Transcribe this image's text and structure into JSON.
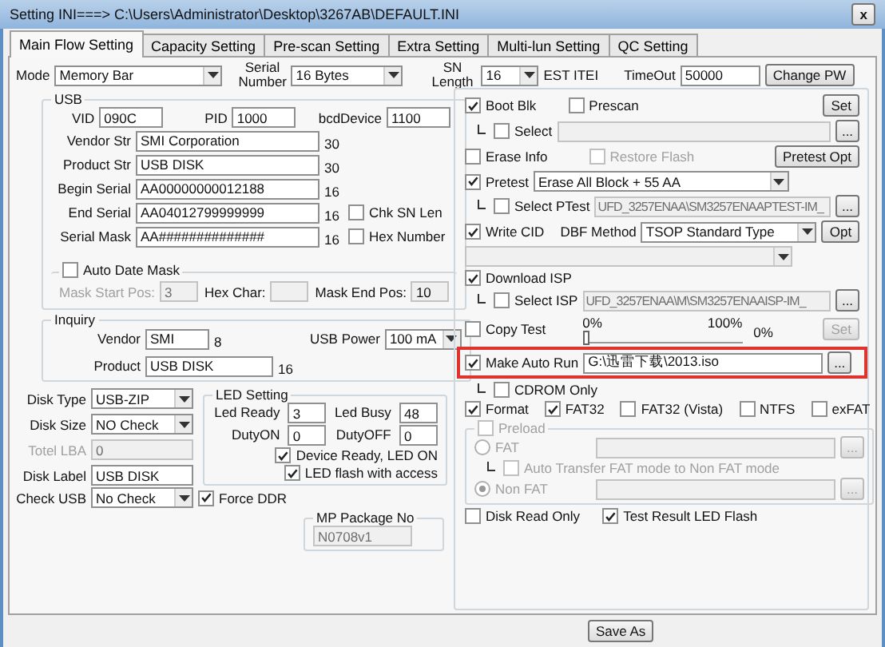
{
  "window": {
    "title": "Setting  INI===> C:\\Users\\Administrator\\Desktop\\3267AB\\DEFAULT.INI",
    "close": "x"
  },
  "tabs": [
    {
      "label": "Main Flow Setting",
      "selected": true
    },
    {
      "label": "Capacity Setting",
      "selected": false
    },
    {
      "label": "Pre-scan Setting",
      "selected": false
    },
    {
      "label": "Extra Setting",
      "selected": false
    },
    {
      "label": "Multi-lun Setting",
      "selected": false
    },
    {
      "label": "QC Setting",
      "selected": false
    }
  ],
  "top": {
    "mode": {
      "label": "Mode",
      "value": "Memory Bar"
    },
    "serial_number": {
      "label": "Serial Number",
      "value": "16 Bytes"
    },
    "sn_length": {
      "label": "SN Length",
      "value": "16"
    },
    "est_item": "EST ITEI",
    "timeout": {
      "label": "TimeOut",
      "value": "50000"
    },
    "change_pw": "Change PW"
  },
  "usb": {
    "title": "USB",
    "ids": [
      {
        "label": "VID",
        "value": "090C"
      },
      {
        "label": "PID",
        "value": "1000"
      },
      {
        "label": "bcdDevice",
        "value": "1100"
      }
    ],
    "strings": [
      {
        "label": "Vendor Str",
        "value": "SMI Corporation",
        "length": "30"
      },
      {
        "label": "Product Str",
        "value": "USB DISK",
        "length": "30"
      },
      {
        "label": "Begin Serial",
        "value": "AA00000000012188",
        "length": "16"
      },
      {
        "label": "End Serial",
        "value": "AA04012799999999",
        "length": "16",
        "option": {
          "label": "Chk SN Len",
          "checked": false
        }
      },
      {
        "label": "Serial Mask",
        "value": "AA##############",
        "length": "16",
        "option": {
          "label": "Hex Number",
          "checked": false
        }
      }
    ],
    "auto_date_mask": {
      "label": "Auto Date Mask",
      "checked": false,
      "fields": [
        {
          "label": "Mask Start Pos:",
          "value": "3",
          "disabled": true
        },
        {
          "label": "Hex Char:",
          "disabled": false
        },
        {
          "label": "Mask End Pos:",
          "value": "10",
          "disabled": false
        }
      ]
    }
  },
  "inquiry": {
    "title": "Inquiry",
    "vendor": {
      "label": "Vendor",
      "value": "SMI",
      "length": "8"
    },
    "usb_power": {
      "label": "USB Power",
      "value": "100 mA"
    },
    "product": {
      "label": "Product",
      "value": "USB DISK",
      "length": "16"
    }
  },
  "disk": [
    {
      "kind": "combo",
      "label": "Disk Type",
      "value": "USB-ZIP",
      "disabled": false
    },
    {
      "kind": "combo",
      "label": "Disk Size",
      "value": "NO Check",
      "disabled": false
    },
    {
      "kind": "field",
      "label": "Totel LBA",
      "value": "0",
      "disabled": true
    },
    {
      "kind": "field",
      "label": "Disk Label",
      "value": "USB DISK",
      "disabled": false
    }
  ],
  "check_usb": {
    "label": "Check USB",
    "value": "No Check",
    "option": {
      "label": "Force DDR",
      "checked": true
    }
  },
  "led": {
    "title": "LED Setting",
    "fields": [
      {
        "label": "Led Ready",
        "value": "3"
      },
      {
        "label": "Led Busy",
        "value": "48"
      },
      {
        "label": "DutyON",
        "value": "0"
      },
      {
        "label": "DutyOFF",
        "value": "0"
      }
    ],
    "checks": [
      {
        "label": "Device Ready, LED ON",
        "checked": true
      },
      {
        "label": "LED flash with access",
        "checked": true
      }
    ]
  },
  "mp_package": {
    "title": "MP Package No",
    "value": "N0708v1"
  },
  "right": {
    "boot_blk": {
      "label": "Boot Blk",
      "checked": true
    },
    "prescan": {
      "label": "Prescan",
      "checked": false
    },
    "set": "Set",
    "boot_select": {
      "label": "Select",
      "checked": false,
      "browse": "..."
    },
    "erase_info": {
      "label": "Erase Info",
      "checked": false
    },
    "restore_flash": {
      "label": "Restore Flash",
      "checked": false,
      "disabled": true
    },
    "pretest_opt": "Pretest Opt",
    "pretest": {
      "label": "Pretest",
      "checked": true,
      "value": "Erase All Block + 55 AA"
    },
    "ptest_select": {
      "label": "Select PTest",
      "checked": false,
      "value": "UFD_3257ENAA\\SM3257ENAAPTEST-IM_",
      "browse": "..."
    },
    "write_cid": {
      "label": "Write CID",
      "checked": true
    },
    "dbf_method": {
      "label": "DBF Method",
      "value": "TSOP Standard Type"
    },
    "opt": "Opt",
    "extra_combo": {
      "disabled": true
    },
    "download_isp": {
      "label": "Download ISP",
      "checked": true
    },
    "isp_select": {
      "label": "Select ISP",
      "checked": false,
      "value": "UFD_3257ENAA\\M\\SM3257ENAAISP-IM_",
      "browse": "..."
    },
    "copy_test": {
      "label": "Copy Test",
      "checked": false,
      "min": "0%",
      "max": "100%",
      "level": 0,
      "reading": "0%",
      "set": {
        "label": "Set",
        "disabled": true
      }
    },
    "auto_run": {
      "label": "Make Auto Run",
      "checked": true,
      "value": "G:\\迅雷下载\\2013.iso",
      "browse": "...",
      "highlighted": true
    },
    "cdrom_only": {
      "label": "CDROM Only",
      "checked": false
    },
    "format": [
      {
        "label": "Format",
        "checked": true
      },
      {
        "label": "FAT32",
        "checked": true
      },
      {
        "label": "FAT32 (Vista)",
        "checked": false
      },
      {
        "label": "NTFS",
        "checked": false
      },
      {
        "label": "exFAT",
        "checked": false
      }
    ],
    "preload": {
      "label": "Preload",
      "checked": false,
      "disabled": true,
      "options": [
        {
          "label": "FAT",
          "selected": false,
          "browse": "..."
        },
        {
          "label": "Non FAT",
          "selected": true,
          "browse": "..."
        }
      ],
      "auto_transfer": {
        "label": "Auto Transfer FAT mode to Non FAT mode",
        "checked": false
      }
    },
    "bottom": [
      {
        "label": "Disk Read Only",
        "checked": false
      },
      {
        "label": "Test Result LED Flash",
        "checked": true
      }
    ]
  },
  "save_as": "Save As"
}
